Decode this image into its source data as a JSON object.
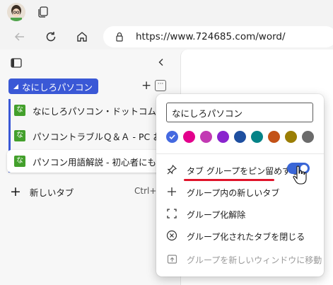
{
  "browser": {
    "url": "https://www.724685.com/word/"
  },
  "sidebar": {
    "group": {
      "name": "なにしろパソコン",
      "plus": "+",
      "more": "···"
    },
    "tabs": [
      {
        "favicon": "な",
        "title": "なにしろパソコン・ドットコム | マルチ"
      },
      {
        "favicon": "な",
        "title": "パソコントラブルＱ＆Ａ - PC お悩み"
      },
      {
        "favicon": "な",
        "title": "パソコン用語解説 - 初心者にもや"
      }
    ],
    "new_tab": {
      "label": "新しいタブ",
      "shortcut": "Ctrl+T"
    }
  },
  "group_menu": {
    "name_value": "なにしろパソコン",
    "colors": [
      "#4469e0",
      "#e3008c",
      "#c239b3",
      "#8a24ce",
      "#1e4fa0",
      "#038387",
      "#c35217",
      "#9b7e04",
      "#6b6b6b"
    ],
    "selected_color_index": 0,
    "items": [
      {
        "icon": "pin-icon",
        "label": "タブ グループをピン留めする",
        "toggle": true,
        "enabled": true
      },
      {
        "icon": "plus-icon",
        "label": "グループ内の新しいタブ",
        "enabled": true
      },
      {
        "icon": "ungroup-icon",
        "label": "グループ化解除",
        "enabled": true
      },
      {
        "icon": "close-circle-icon",
        "label": "グループ化されたタブを閉じる",
        "enabled": true
      },
      {
        "icon": "move-window-icon",
        "label": "グループを新しいウィンドウに移動",
        "enabled": false
      }
    ]
  }
}
